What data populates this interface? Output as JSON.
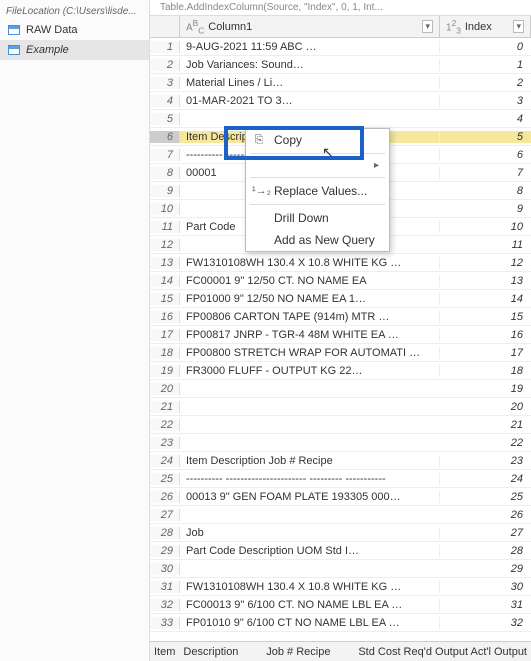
{
  "nav": {
    "crumb": "FileLocation (C:\\Users\\lisde...",
    "items": [
      {
        "label": "RAW Data",
        "selected": false
      },
      {
        "label": "Example",
        "selected": true
      }
    ]
  },
  "formula_preview": "Table.AddIndexColumn(Source, \"Index\", 0, 1, Int...",
  "columns": {
    "col1": {
      "type": "ABC",
      "name": "Column1"
    },
    "col2": {
      "type": "123",
      "name": "Index"
    }
  },
  "rows": [
    {
      "n": 1,
      "c1": "9-AUG-2021 11:59                                ABC …",
      "c2": "0"
    },
    {
      "n": 2,
      "c1": "                          Job Variances: Sound…",
      "c2": "1"
    },
    {
      "n": 3,
      "c1": "                          Material Lines / Li…",
      "c2": "2"
    },
    {
      "n": 4,
      "c1": "                          01-MAR-2021 TO 3…",
      "c2": "3"
    },
    {
      "n": 5,
      "c1": "",
      "c2": "4"
    },
    {
      "n": 6,
      "c1": "Item      Description           Job #  Recipe",
      "c2": "5",
      "selected": true
    },
    {
      "n": 7,
      "c1": "----------   ----------------------     ---------  -----------",
      "c2": "6"
    },
    {
      "n": 8,
      "c1": "00001",
      "c2": "7"
    },
    {
      "n": 9,
      "c1": "",
      "c2": "8"
    },
    {
      "n": 10,
      "c1": "",
      "c2": "9"
    },
    {
      "n": 11,
      "c1": "  Part Code",
      "c2": "10"
    },
    {
      "n": 12,
      "c1": "",
      "c2": "11"
    },
    {
      "n": 13,
      "c1": "  FW1310108WH   130.4 X 10.8        WHITE KG  …",
      "c2": "12"
    },
    {
      "n": 14,
      "c1": "  FC00001     9\" 12/50 CT. NO NAME     EA",
      "c2": "13"
    },
    {
      "n": 15,
      "c1": "  FP01000     9\" 12/50 NO NAME         EA     1…",
      "c2": "14"
    },
    {
      "n": 16,
      "c1": "  FP00806     CARTON TAPE (914m)      MTR  …",
      "c2": "15"
    },
    {
      "n": 17,
      "c1": "  FP00817     JNRP - TGR-4 48M WHITE   EA  …",
      "c2": "16"
    },
    {
      "n": 18,
      "c1": "  FP00800     STRETCH WRAP FOR AUTOMATI …",
      "c2": "17"
    },
    {
      "n": 19,
      "c1": "  FR3000      FLUFF - OUTPUT           KG      22…",
      "c2": "18"
    },
    {
      "n": 20,
      "c1": "",
      "c2": "19"
    },
    {
      "n": 21,
      "c1": "",
      "c2": "20"
    },
    {
      "n": 22,
      "c1": "",
      "c2": "21"
    },
    {
      "n": 23,
      "c1": "",
      "c2": "22"
    },
    {
      "n": 24,
      "c1": "Item        Description            Job #  Recipe",
      "c2": "23"
    },
    {
      "n": 25,
      "c1": "----------   ----------------------     ---------  -----------",
      "c2": "24"
    },
    {
      "n": 26,
      "c1": "00013    9\" GEN FOAM PLATE        193305 000…",
      "c2": "25"
    },
    {
      "n": 27,
      "c1": "",
      "c2": "26"
    },
    {
      "n": 28,
      "c1": "                                   Job",
      "c2": "27"
    },
    {
      "n": 29,
      "c1": "  Part Code   Description           UOM    Std I…",
      "c2": "28"
    },
    {
      "n": 30,
      "c1": "",
      "c2": "29"
    },
    {
      "n": 31,
      "c1": "  FW1310108WH  130.4 X 10.8        WHITE KG  …",
      "c2": "30"
    },
    {
      "n": 32,
      "c1": "  FC00013     9\" 6/100 CT. NO NAME LBL  EA  …",
      "c2": "31"
    },
    {
      "n": 33,
      "c1": "  FP01010     9\" 6/100 CT NO NAME LBL  EA  …",
      "c2": "32"
    }
  ],
  "context_menu": {
    "copy": "Copy",
    "filters_sub": "",
    "replace": "Replace Values...",
    "drill": "Drill Down",
    "addnew": "Add as New Query"
  },
  "status": {
    "s1": "Item",
    "s2": "Description",
    "s3": "Job #  Recipe",
    "s4": "Std Cost Req'd Output Act'l Output"
  }
}
